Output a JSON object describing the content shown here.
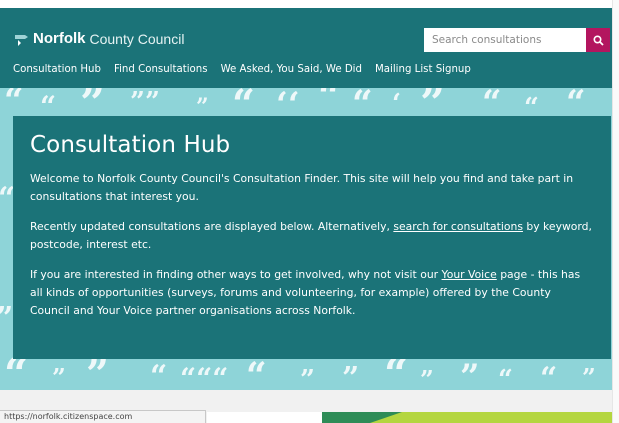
{
  "header": {
    "logo_bold": "Norfolk",
    "logo_rest": "County Council",
    "search_placeholder": "Search consultations"
  },
  "nav": {
    "items": [
      "Consultation Hub",
      "Find Consultations",
      "We Asked, You Said, We Did",
      "Mailing List Signup"
    ]
  },
  "hero": {
    "title": "Consultation Hub",
    "p1": "Welcome to Norfolk County Council's Consultation Finder. This site will help you find and take part in consultations that interest you.",
    "p2_before": "Recently updated consultations are displayed below. Alternatively, ",
    "p2_link": "search for consultations",
    "p2_after": " by keyword, postcode, interest etc.",
    "p3_before": "If you are interested in finding other ways to get involved, why not visit our ",
    "p3_link": "Your Voice",
    "p3_after": " page - this has all kinds of opportunities (surveys, forums and volunteering, for example) offered by the County Council and Your Voice partner organisations across Norfolk."
  },
  "status_url": "https://norfolk.citizenspace.com",
  "colors": {
    "teal": "#1b7378",
    "light_teal": "#8ed4d8",
    "accent": "#b3155f"
  }
}
